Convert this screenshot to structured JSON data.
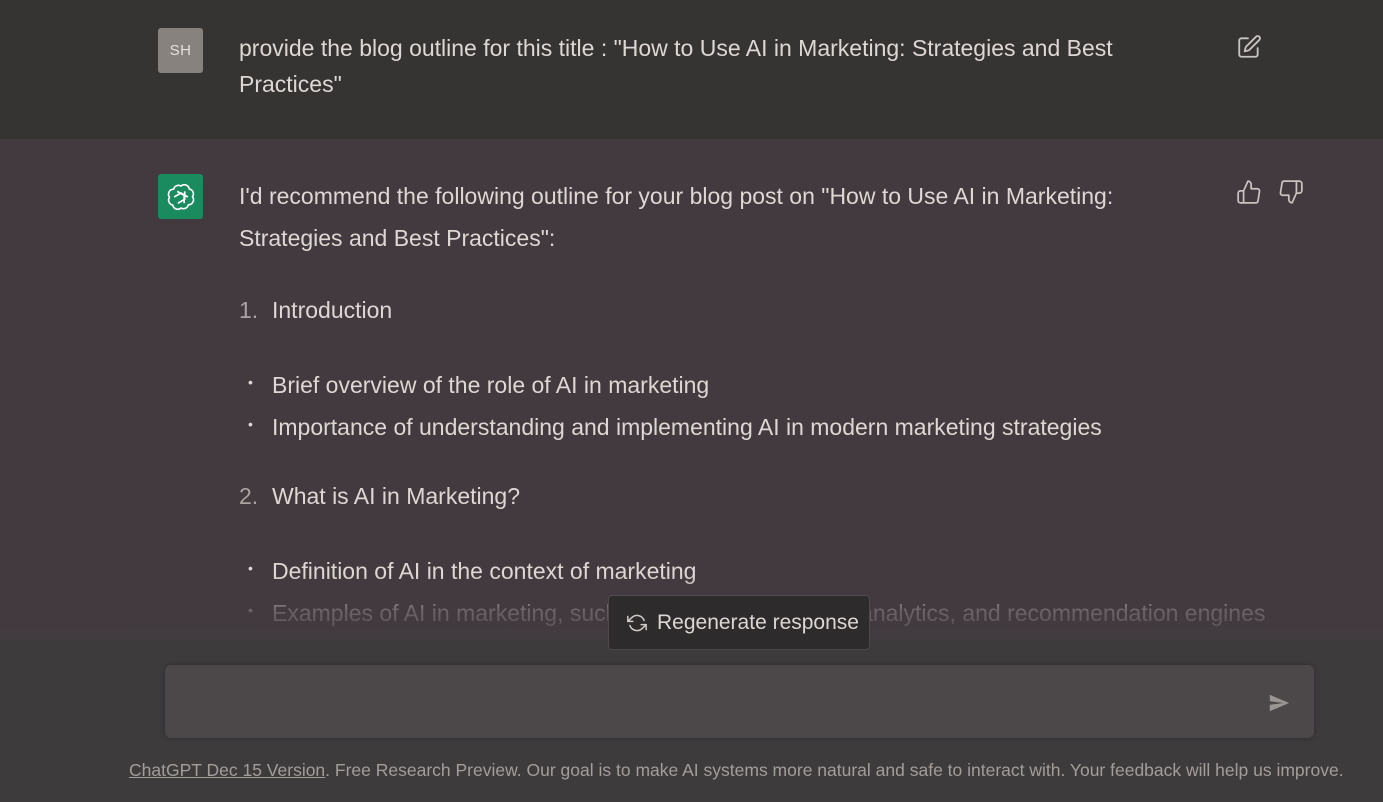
{
  "user_message": {
    "avatar_initials": "SH",
    "text": "provide the blog outline for this title : \"How to Use AI in Marketing: Strategies and Best Practices\"",
    "edit_icon": "edit-icon"
  },
  "assistant_message": {
    "intro": "I'd recommend the following outline for your blog post on \"How to Use AI in Marketing: Strategies and Best Practices\":",
    "outline": [
      {
        "number": "1.",
        "title": "Introduction",
        "bullets": [
          "Brief overview of the role of AI in marketing",
          "Importance of understanding and implementing AI in modern marketing strategies"
        ]
      },
      {
        "number": "2.",
        "title": "What is AI in Marketing?",
        "bullets": [
          "Definition of AI in the context of marketing",
          "Examples of AI in marketing, such as chatbots, predictive analytics, and recommendation engines"
        ]
      }
    ],
    "thumbs_up_icon": "thumbs-up-icon",
    "thumbs_down_icon": "thumbs-down-icon"
  },
  "regenerate_button": {
    "label": "Regenerate response",
    "icon": "refresh-icon"
  },
  "composer": {
    "value": "",
    "placeholder": "",
    "send_icon": "send-icon"
  },
  "footer": {
    "version_link": "ChatGPT Dec 15 Version",
    "text": ". Free Research Preview. Our goal is to make AI systems more natural and safe to interact with. Your feedback will help us improve."
  },
  "colors": {
    "user_band": "#363333",
    "assistant_band": "#433a3f",
    "bot_avatar": "#1a8a5f",
    "user_avatar": "#88827e"
  }
}
